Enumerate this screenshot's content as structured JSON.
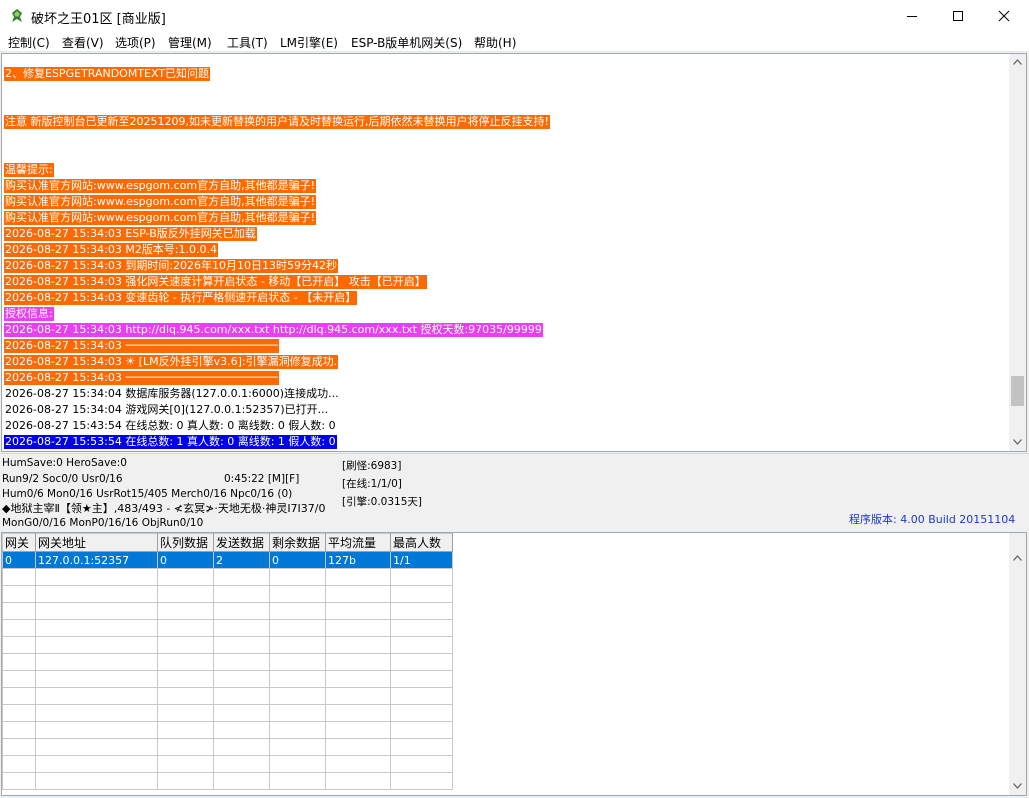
{
  "window": {
    "title": "破坏之王01区 [商业版]"
  },
  "menu": [
    {
      "label": "控制(C)"
    },
    {
      "label": "查看(V)"
    },
    {
      "label": "选项(P)"
    },
    {
      "label": "管理(M)"
    },
    {
      "label": "工具(T)"
    },
    {
      "label": "LM引擎(E)"
    },
    {
      "label": "ESP-B版单机网关(S)"
    },
    {
      "label": "帮助(H)"
    }
  ],
  "log": [
    {
      "text": "2、修复ESPGETRANDOMTEXT已知问题",
      "style": "orange"
    },
    {
      "text": "注意 新版控制台已更新至20251209,如未更新替换的用户请及时替换运行,后期依然未替换用户将停止反挂支持!",
      "style": "orange"
    },
    {
      "text": "温馨提示:",
      "style": "orange"
    },
    {
      "text": "购买认准官方网站:www.espgom.com官方自助,其他都是骗子!",
      "style": "orange"
    },
    {
      "text": "购买认准官方网站:www.espgom.com官方自助,其他都是骗子!",
      "style": "orange"
    },
    {
      "text": "购买认准官方网站:www.espgom.com官方自助,其他都是骗子!",
      "style": "orange"
    },
    {
      "text": "2026-08-27 15:34:03 ESP-B版反外挂网关已加载",
      "style": "orange"
    },
    {
      "text": "2026-08-27 15:34:03 M2版本号:1.0.0.4",
      "style": "orange"
    },
    {
      "text": "2026-08-27 15:34:03 到期时间:2026年10月10日13时59分42秒",
      "style": "orange"
    },
    {
      "text": "2026-08-27 15:34:03 强化网关速度计算开启状态 - 移动【已开启】 攻击【已开启】",
      "style": "orange"
    },
    {
      "text": "2026-08-27 15:34:03 变速齿轮 - 执行严格侧速开启状态 - 【未开启】",
      "style": "orange"
    },
    {
      "text": "授权信息:",
      "style": "magenta"
    },
    {
      "text": "2026-08-27 15:34:03 http://dlq.945.com/xxx.txt http://dlq.945.com/xxx.txt 授权天数:97035/99999",
      "style": "magenta"
    },
    {
      "text": "2026-08-27 15:34:03 ───────────────────────",
      "style": "orange"
    },
    {
      "text": "2026-08-27 15:34:03 ☀ [LM反外挂引擎v3.6]:引擎漏洞修复成功.",
      "style": "orange"
    },
    {
      "text": "2026-08-27 15:34:03 ───────────────────────",
      "style": "orange"
    },
    {
      "text": "2026-08-27 15:34:04 数据库服务器(127.0.0.1:6000)连接成功...",
      "style": "plain"
    },
    {
      "text": "2026-08-27 15:34:04 游戏网关[0](127.0.0.1:52357)已打开...",
      "style": "plain"
    },
    {
      "text": "2026-08-27 15:43:54 在线总数: 0 真人数: 0 离线数: 0 假人数: 0",
      "style": "plain"
    },
    {
      "text": "2026-08-27 15:53:54 在线总数: 1 真人数: 0 离线数: 1 假人数: 0",
      "style": "blue"
    }
  ],
  "status": {
    "hum_save": "HumSave:0 HeroSave:0",
    "run": "Run9/2 Soc0/0 Usr0/16",
    "timer": "0:45:22 [M][F]",
    "refresh": "[刷怪:6983]",
    "online": "[在线:1/1/0]",
    "hum": "Hum0/6 Mon0/16 UsrRot15/405 Merch0/16 Npc0/16 (0)",
    "engine": "[引擎:0.0315天]",
    "monster": "◆地狱主宰Ⅱ【领★主】,483/493 - ≮玄冥≯·天地无极·神灵I7I37/0",
    "mongen": "MonG0/0/16 MonP0/16/16 ObjRun0/10",
    "version": "程序版本: 4.00 Build 20151104"
  },
  "grid": {
    "columns": [
      "网关",
      "网关地址",
      "队列数据",
      "发送数据",
      "剩余数据",
      "平均流量",
      "最高人数"
    ],
    "rows": [
      [
        "0",
        "127.0.0.1:52357",
        "0",
        "2",
        "0",
        "127b",
        "1/1"
      ]
    ]
  }
}
